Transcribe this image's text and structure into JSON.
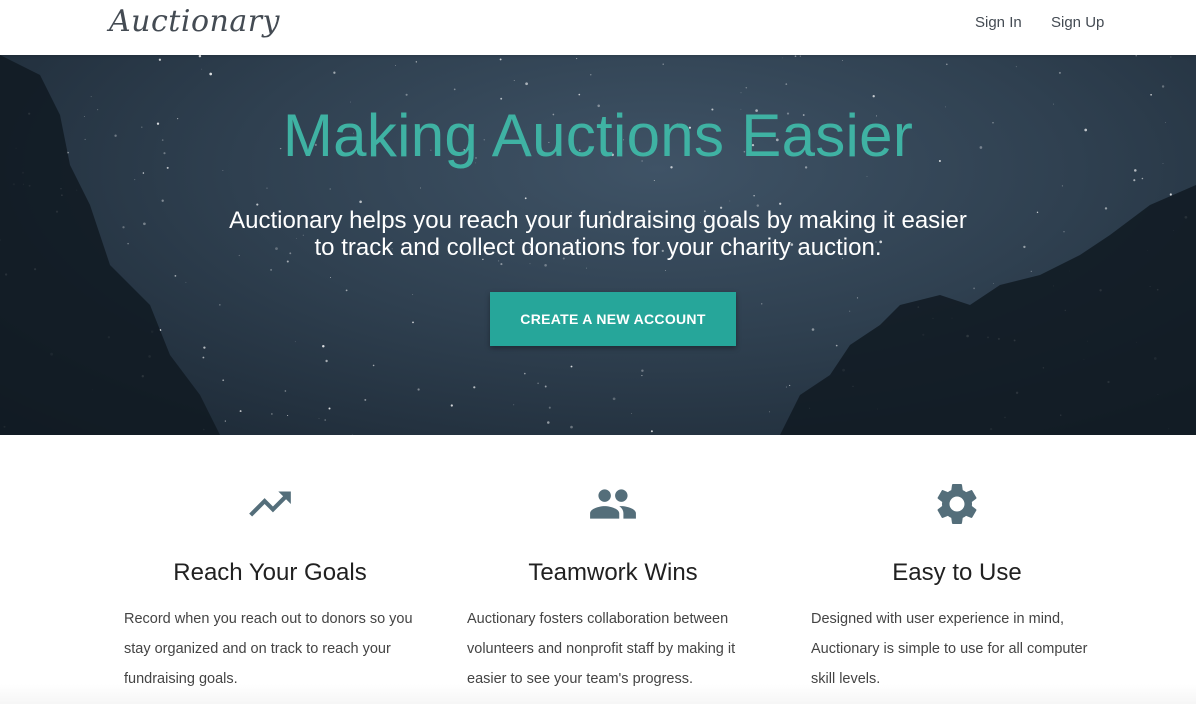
{
  "header": {
    "brand": "Auctionary",
    "nav": {
      "sign_in": "Sign In",
      "sign_up": "Sign Up"
    }
  },
  "hero": {
    "title": "Making Auctions Easier",
    "subtitle_line1": "Auctionary helps you reach your fundraising goals by making it easier",
    "subtitle_line2": "to track and collect donations for your charity auction.",
    "cta_label": "CREATE A NEW ACCOUNT"
  },
  "features": [
    {
      "icon": "trending-up-icon",
      "title": "Reach Your Goals",
      "text": "Record when you reach out to donors so you stay organized and on track to reach your fundraising goals."
    },
    {
      "icon": "people-icon",
      "title": "Teamwork Wins",
      "text": "Auctionary fosters collaboration between volunteers and nonprofit staff by making it easier to see your team's progress."
    },
    {
      "icon": "gear-icon",
      "title": "Easy to Use",
      "text": "Designed with user experience in mind, Auctionary is simple to use for all computer skill levels."
    }
  ],
  "colors": {
    "accent": "#26a69a",
    "hero_title": "#3fb2a3",
    "icon": "#546e7a",
    "hero_background": "#2f4050"
  }
}
